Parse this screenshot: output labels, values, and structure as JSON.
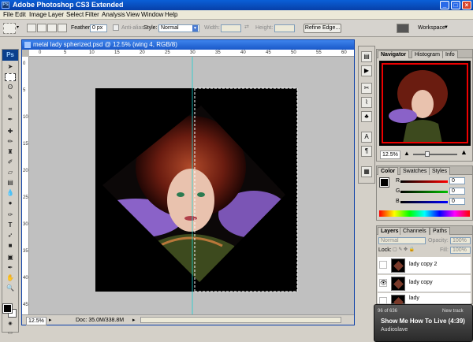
{
  "window": {
    "title": "Adobe Photoshop CS3 Extended",
    "ps_mark": "Ps"
  },
  "menu": [
    "File",
    "Edit",
    "Image",
    "Layer",
    "Select",
    "Filter",
    "Analysis",
    "View",
    "Window",
    "Help"
  ],
  "options": {
    "feather_label": "Feather:",
    "feather_value": "0 px",
    "antialias_label": "Anti-alias",
    "style_label": "Style:",
    "style_value": "Normal",
    "width_label": "Width:",
    "height_label": "Height:",
    "refine_edge": "Refine Edge...",
    "workspace": "Workspace"
  },
  "toolbox": {
    "logo": "Ps"
  },
  "document": {
    "title": "metal lady spherized.psd @ 12.5% (wing 4, RGB/8)",
    "zoom": "12.5%",
    "doc_info": "Doc: 35.0M/338.8M"
  },
  "rulers": {
    "h_ticks": [
      "0",
      "5",
      "10",
      "15",
      "20",
      "25",
      "30",
      "35",
      "40",
      "45",
      "50",
      "55",
      "60"
    ],
    "v_ticks": [
      "0",
      "5",
      "10",
      "15",
      "20",
      "25",
      "30",
      "35",
      "40",
      "45"
    ]
  },
  "navigator": {
    "tabs": [
      "Navigator",
      "Histogram",
      "Info"
    ],
    "zoom": "12.5%",
    "zoom_level": 0.3
  },
  "color": {
    "tabs": [
      "Color",
      "Swatches",
      "Styles"
    ],
    "channels": [
      {
        "label": "R",
        "value": "0",
        "color": "#ff0000"
      },
      {
        "label": "G",
        "value": "0",
        "color": "#00c000"
      },
      {
        "label": "B",
        "value": "0",
        "color": "#0000ff"
      }
    ]
  },
  "layers": {
    "tabs": [
      "Layers",
      "Channels",
      "Paths"
    ],
    "blend_mode": "Normal",
    "opacity_label": "Opacity:",
    "opacity_value": "100%",
    "lock_label": "Lock:",
    "fill_label": "Fill:",
    "fill_value": "100%",
    "items": [
      {
        "name": "lady copy 2",
        "visible": false
      },
      {
        "name": "lady copy",
        "visible": true
      },
      {
        "name": "lady",
        "visible": false
      }
    ]
  },
  "music": {
    "position": "96 of 636",
    "label": "New track",
    "title": "Show Me How To Live (4:39)",
    "artist": "Audioslave"
  },
  "colors": {
    "accent": "#0a5fd8",
    "canvas": "#c0c0c0"
  }
}
